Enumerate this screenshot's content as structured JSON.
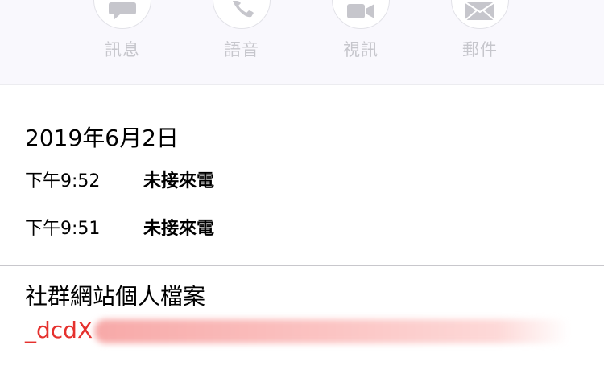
{
  "actions": [
    {
      "label": "訊息",
      "icon": "message-icon"
    },
    {
      "label": "語音",
      "icon": "phone-icon"
    },
    {
      "label": "視訊",
      "icon": "video-icon"
    },
    {
      "label": "郵件",
      "icon": "mail-icon"
    }
  ],
  "history": {
    "date": "2019年6月2日",
    "calls": [
      {
        "time": "下午9:52",
        "status": "未接來電"
      },
      {
        "time": "下午9:51",
        "status": "未接來電"
      }
    ]
  },
  "profile": {
    "title": "社群網站個人檔案",
    "link_visible": "_dcdX"
  },
  "colors": {
    "link": "#e5312e",
    "action_bar_bg": "#f9f8fd",
    "action_label": "#c6c6cc"
  }
}
